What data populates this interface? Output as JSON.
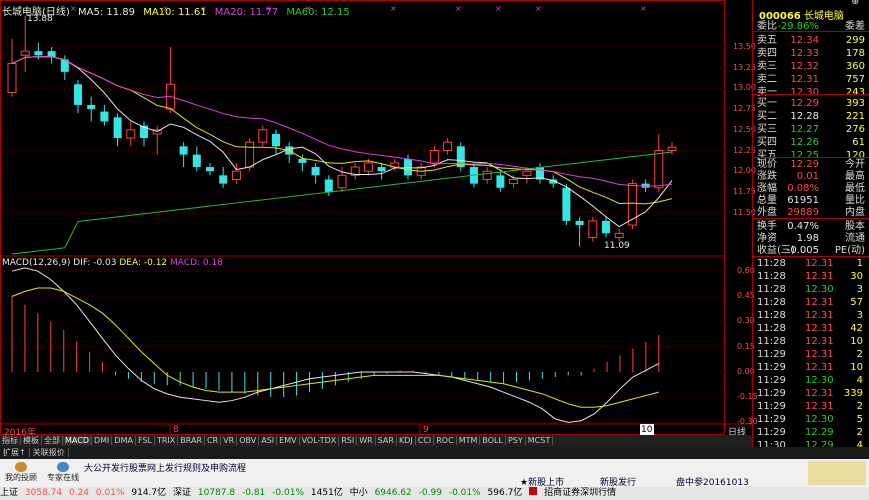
{
  "header": {
    "stock_label": "长城电脑(日线)",
    "ma5": "MA5: 11.89",
    "ma10": "MA10: 11.61",
    "ma20": "MA20: 11.77",
    "ma60": "MA60: 12.15"
  },
  "price_axis": [
    "13.50",
    "13.25",
    "13.00",
    "12.75",
    "12.50",
    "12.25",
    "12.00",
    "11.75",
    "11.50"
  ],
  "annotations": {
    "high": "13.88",
    "low": "11.09"
  },
  "macd": {
    "label": "MACD(12,26,9)",
    "dif": "DIF: -0.03",
    "dea": "DEA: -0.12",
    "macd": "MACD: 0.18",
    "axis": [
      "0.60",
      "0.45",
      "0.30",
      "0.15",
      "0.00",
      "-0.15",
      "-0.30"
    ]
  },
  "date_axis": {
    "year": "2016年",
    "m8": "8",
    "m9": "9",
    "m10": "10",
    "period": "日线"
  },
  "quote": {
    "code": "000066",
    "name": "长城电脑",
    "weibi_label": "委比",
    "weibi": "-29.86%",
    "weicha_label": "委差",
    "asks": [
      {
        "label": "卖五",
        "price": "12.34",
        "vol": "299"
      },
      {
        "label": "卖四",
        "price": "12.33",
        "vol": "178"
      },
      {
        "label": "卖三",
        "price": "12.32",
        "vol": "360"
      },
      {
        "label": "卖二",
        "price": "12.31",
        "vol": "757"
      },
      {
        "label": "卖一",
        "price": "12.30",
        "vol": "243"
      }
    ],
    "bids": [
      {
        "label": "买一",
        "price": "12.29",
        "vol": "393"
      },
      {
        "label": "买二",
        "price": "12.28",
        "vol": "221"
      },
      {
        "label": "买三",
        "price": "12.27",
        "vol": "276"
      },
      {
        "label": "买四",
        "price": "12.26",
        "vol": "61"
      },
      {
        "label": "买五",
        "price": "12.25",
        "vol": "120"
      }
    ],
    "stats": [
      {
        "l1": "现价",
        "v1": "12.29",
        "l2": "今开",
        "c": "red"
      },
      {
        "l1": "涨跌",
        "v1": "0.01",
        "l2": "最高",
        "c": "red"
      },
      {
        "l1": "涨幅",
        "v1": "0.08%",
        "l2": "最低",
        "c": "red"
      },
      {
        "l1": "总量",
        "v1": "61951",
        "l2": "量比",
        "c": "wht"
      },
      {
        "l1": "外盘",
        "v1": "29889",
        "l2": "内盘",
        "c": "red"
      }
    ],
    "stats2": [
      {
        "l1": "换手",
        "v1": "0.47%",
        "l2": "股本"
      },
      {
        "l1": "净资",
        "v1": "1.98",
        "l2": "流通"
      },
      {
        "l1": "收益(三)",
        "v1": "-0.005",
        "l2": "PE(动)"
      }
    ],
    "trades": [
      {
        "t": "11:28",
        "p": "12.31",
        "q": "1",
        "c": "red"
      },
      {
        "t": "11:28",
        "p": "12.31",
        "q": "30",
        "c": "red"
      },
      {
        "t": "11:28",
        "p": "12.30",
        "q": "3",
        "c": "green"
      },
      {
        "t": "11:28",
        "p": "12.31",
        "q": "57",
        "c": "red"
      },
      {
        "t": "11:28",
        "p": "12.31",
        "q": "3",
        "c": "red"
      },
      {
        "t": "11:28",
        "p": "12.31",
        "q": "42",
        "c": "red"
      },
      {
        "t": "11:28",
        "p": "12.31",
        "q": "10",
        "c": "red"
      },
      {
        "t": "11:29",
        "p": "12.31",
        "q": "2",
        "c": "red"
      },
      {
        "t": "11:29",
        "p": "12.31",
        "q": "10",
        "c": "red"
      },
      {
        "t": "11:29",
        "p": "12.30",
        "q": "4",
        "c": "green"
      },
      {
        "t": "11:29",
        "p": "12.31",
        "q": "339",
        "c": "red"
      },
      {
        "t": "11:29",
        "p": "12.31",
        "q": "2",
        "c": "red"
      },
      {
        "t": "11:29",
        "p": "12.30",
        "q": "5",
        "c": "green"
      },
      {
        "t": "11:29",
        "p": "12.29",
        "q": "2",
        "c": "green"
      },
      {
        "t": "11:30",
        "p": "12.29",
        "q": "4",
        "c": "green"
      }
    ]
  },
  "tabs": [
    "指标",
    "模板",
    "全部",
    "MACD",
    "DMI",
    "DMA",
    "FSL",
    "TRIX",
    "BRAR",
    "CR",
    "VR",
    "OBV",
    "ASI",
    "EMV",
    "VOL-TDX",
    "RSI",
    "WR",
    "SAR",
    "KDJ",
    "CCI",
    "ROC",
    "MTM",
    "BOLL",
    "PSY",
    "MCST"
  ],
  "subtabs": [
    "扩展↑",
    "关联报价"
  ],
  "news": {
    "my_label": "我的投顾",
    "expert_label": "专家在线",
    "headline": "大公开发行股票网上发行规则及申购流程",
    "link1": "★新股上市",
    "link2": "新股发行",
    "link3": "盘中参20161013"
  },
  "status": {
    "sh_label": "上证",
    "sh_val": "3058.74",
    "sh_chg": "0.24",
    "sh_pct": "0.01%",
    "sh_amt": "914.7亿",
    "sz_label": "深证",
    "sz_val": "10787.8",
    "sz_chg": "-0.81",
    "sz_pct": "-0.01%",
    "sz_amt": "1451亿",
    "zx_label": "中小",
    "zx_val": "6946.62",
    "zx_chg": "-0.99",
    "zx_pct": "-0.01%",
    "zx_amt": "596.7亿",
    "broker": "招商证券深圳行情"
  }
}
